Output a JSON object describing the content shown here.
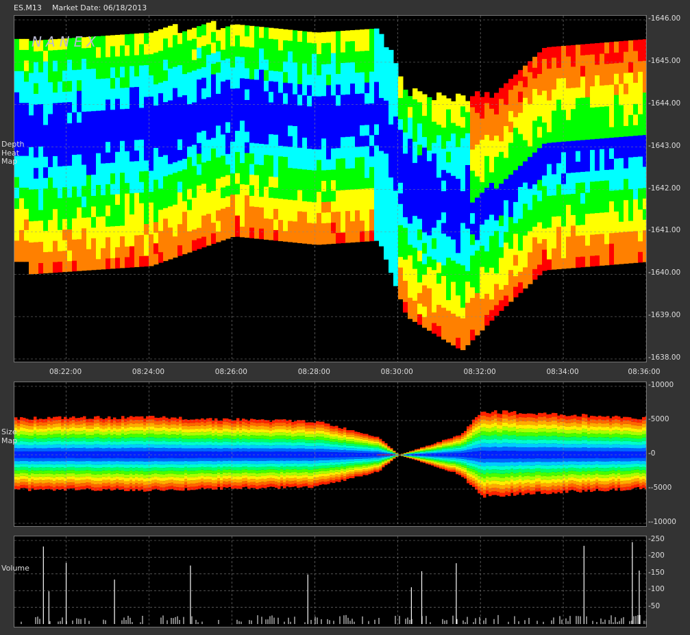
{
  "header": {
    "symbol": "ES.M13",
    "market_date": "Market Date: 06/18/2013"
  },
  "logo": "NANEX",
  "panels": {
    "heatmap": {
      "label": "Depth\nHeat\nMap"
    },
    "size": {
      "label": "Size\nMap"
    },
    "volume": {
      "label": "Volume"
    }
  },
  "chart_data": [
    {
      "type": "heatmap",
      "title": "",
      "ylabel": "",
      "y_ticks": [
        "1646.00",
        "1645.00",
        "1644.00",
        "1643.00",
        "1642.00",
        "1641.00",
        "1640.00",
        "1639.00",
        "1638.00"
      ],
      "x_ticks": [
        "08:22:00",
        "08:24:00",
        "08:26:00",
        "08:28:00",
        "08:30:00",
        "08:32:00",
        "08:34:00",
        "08:36:00"
      ],
      "ylim": [
        1638.0,
        1646.0
      ],
      "grid": true,
      "colors": [
        "#0000ff",
        "#00ffff",
        "#00ff00",
        "#ffff00",
        "#ff8000",
        "#ff0000"
      ],
      "price_range_over_time": [
        {
          "time": "08:21:00",
          "low": 1640.0,
          "high": 1645.5
        },
        {
          "time": "08:24:00",
          "low": 1640.2,
          "high": 1645.6
        },
        {
          "time": "08:26:00",
          "low": 1640.9,
          "high": 1645.8
        },
        {
          "time": "08:28:00",
          "low": 1640.7,
          "high": 1645.6
        },
        {
          "time": "08:29:30",
          "low": 1640.8,
          "high": 1645.7
        },
        {
          "time": "08:30:10",
          "low": 1639.0,
          "high": 1644.2
        },
        {
          "time": "08:31:30",
          "low": 1638.2,
          "high": 1644.0
        },
        {
          "time": "08:32:30",
          "low": 1639.2,
          "high": 1644.2
        },
        {
          "time": "08:33:30",
          "low": 1640.1,
          "high": 1645.2
        },
        {
          "time": "08:36:00",
          "low": 1640.3,
          "high": 1645.4
        }
      ]
    },
    {
      "type": "area",
      "title": "",
      "y_ticks": [
        "10000",
        "5000",
        "0",
        "-5000",
        "-10000"
      ],
      "ylim": [
        -10000,
        10000
      ],
      "grid": true,
      "series": [
        {
          "x": [
            "08:21:00",
            "08:24:00",
            "08:26:00",
            "08:28:00",
            "08:29:30",
            "08:30:00",
            "08:31:30",
            "08:32:00",
            "08:34:00",
            "08:36:00"
          ],
          "bid": [
            5500,
            5600,
            5300,
            5000,
            2700,
            0,
            3000,
            6500,
            6000,
            5500
          ],
          "ask": [
            -5200,
            -5300,
            -5000,
            -4800,
            -2500,
            0,
            -3000,
            -6200,
            -5500,
            -5000
          ]
        }
      ]
    },
    {
      "type": "bar",
      "title": "",
      "y_ticks": [
        "250",
        "200",
        "150",
        "100",
        "50"
      ],
      "ylim": [
        0,
        250
      ],
      "grid": true,
      "bars": [
        {
          "time": "08:21:27",
          "value": 232
        },
        {
          "time": "08:21:35",
          "value": 98
        },
        {
          "time": "08:22:00",
          "value": 183
        },
        {
          "time": "08:23:10",
          "value": 133
        },
        {
          "time": "08:25:00",
          "value": 175
        },
        {
          "time": "08:27:50",
          "value": 148
        },
        {
          "time": "08:30:20",
          "value": 110
        },
        {
          "time": "08:30:35",
          "value": 158
        },
        {
          "time": "08:31:25",
          "value": 182
        },
        {
          "time": "08:34:30",
          "value": 234
        },
        {
          "time": "08:35:40",
          "value": 245
        },
        {
          "time": "08:35:50",
          "value": 160
        }
      ]
    }
  ]
}
